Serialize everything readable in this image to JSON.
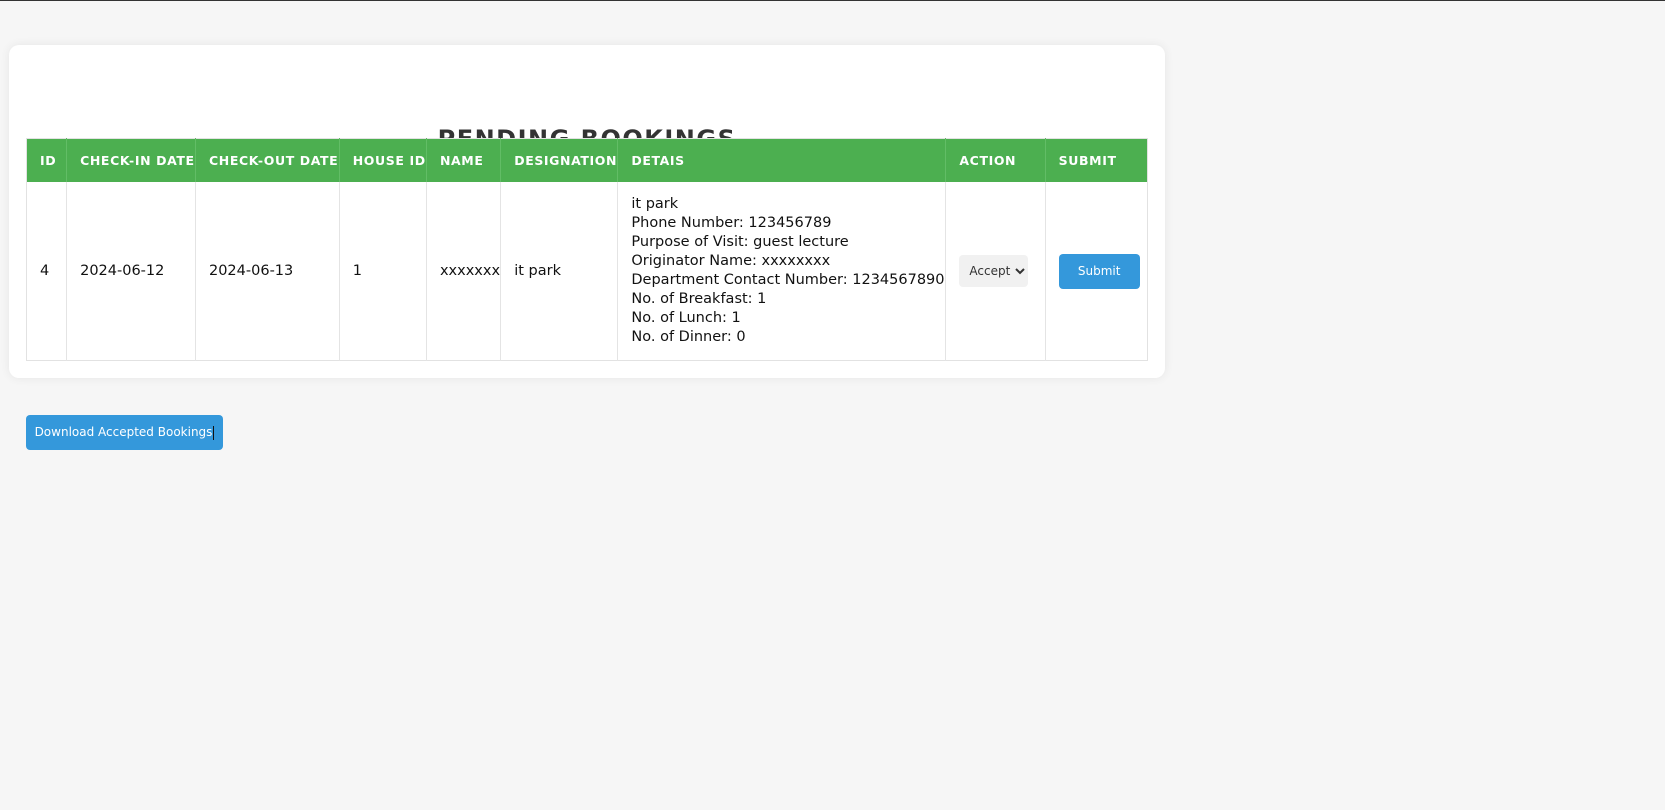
{
  "page": {
    "title": "PENDING BOOKINGS"
  },
  "table": {
    "headers": [
      "ID",
      "CHECK-IN DATE",
      "CHECK-OUT DATE",
      "HOUSE ID",
      "NAME",
      "DESIGNATION",
      "DETAIS",
      "ACTION",
      "SUBMIT"
    ],
    "rows": [
      {
        "id": "4",
        "check_in": "2024-06-12",
        "check_out": "2024-06-13",
        "house_id": "1",
        "name": "xxxxxxx",
        "designation": "it park",
        "details": [
          "it park",
          "Phone Number: 123456789",
          "Purpose of Visit: guest lecture",
          "Originator Name: xxxxxxxx",
          "Department Contact Number: 1234567890",
          "No. of Breakfast: 1",
          "No. of Lunch: 1",
          "No. of Dinner: 0"
        ],
        "action_selected": "Accept",
        "submit_label": "Submit"
      }
    ]
  },
  "download_label": "Download Accepted Bookings",
  "colors": {
    "header_bg": "#4caf50",
    "button_bg": "#3498db",
    "page_bg": "#f6f6f6"
  }
}
